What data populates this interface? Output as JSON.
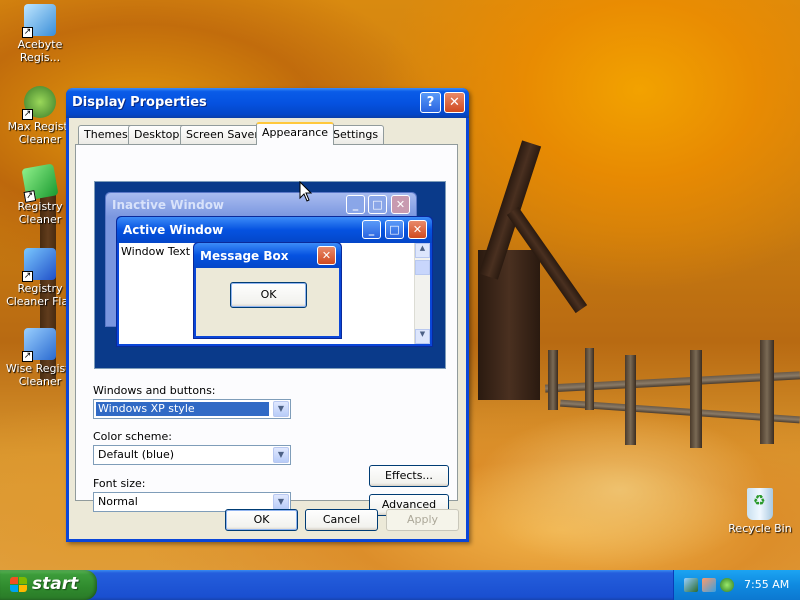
{
  "desktop": {
    "icons": [
      {
        "label": "Acebyte Regis..."
      },
      {
        "label": "Max Registr Cleaner"
      },
      {
        "label": "Registry Cleaner"
      },
      {
        "label": "Registry Cleaner Flas"
      },
      {
        "label": "Wise Registr Cleaner"
      },
      {
        "label": "Recycle Bin"
      }
    ]
  },
  "window": {
    "title": "Display Properties",
    "help_glyph": "?",
    "close_glyph": "✕",
    "tabs": [
      {
        "label": "Themes"
      },
      {
        "label": "Desktop"
      },
      {
        "label": "Screen Saver"
      },
      {
        "label": "Appearance"
      },
      {
        "label": "Settings"
      }
    ],
    "active_tab": "Appearance",
    "preview": {
      "inactive_title": "Inactive Window",
      "active_title": "Active Window",
      "window_text": "Window Text",
      "message_title": "Message Box",
      "message_ok": "OK"
    },
    "fields": {
      "windows_buttons": {
        "label": "Windows and buttons:",
        "value": "Windows XP style"
      },
      "color_scheme": {
        "label": "Color scheme:",
        "value": "Default (blue)"
      },
      "font_size": {
        "label": "Font size:",
        "value": "Normal"
      }
    },
    "buttons": {
      "effects": "Effects...",
      "advanced": "Advanced",
      "ok": "OK",
      "cancel": "Cancel",
      "apply": "Apply"
    }
  },
  "taskbar": {
    "start_label": "start",
    "clock": "7:55 AM"
  },
  "colors": {
    "titlebar_blue": "#0552e0",
    "start_green": "#3c9c3a",
    "selection_blue": "#316ac5",
    "tab_highlight": "#ffc83c"
  }
}
